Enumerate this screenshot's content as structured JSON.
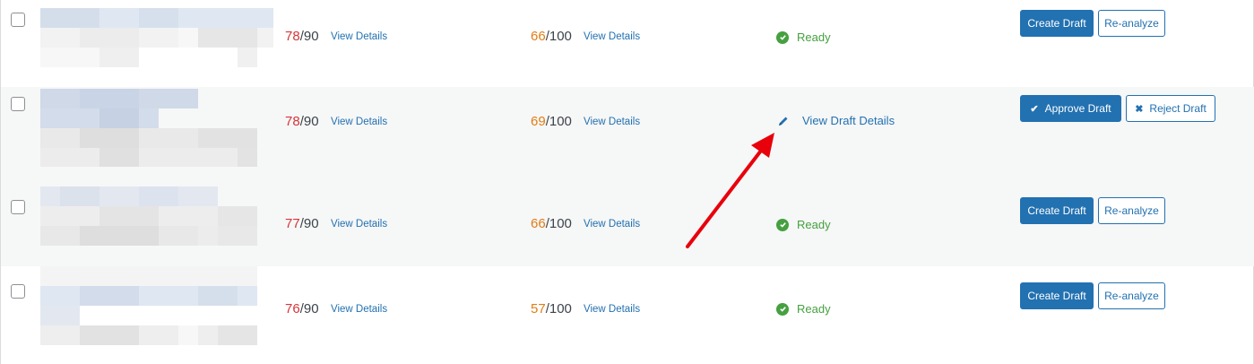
{
  "rows": [
    {
      "seo_value": "78",
      "seo_total": "/90",
      "seo_link": "View Details",
      "read_value": "66",
      "read_total": "/100",
      "read_link": "View Details",
      "status": "Ready",
      "btn1": "Create Draft",
      "btn2": "Re-analyze"
    },
    {
      "seo_value": "78",
      "seo_total": "/90",
      "seo_link": "View Details",
      "read_value": "69",
      "read_total": "/100",
      "read_link": "View Details",
      "draft_link": "View Draft Details",
      "btn1": "Approve Draft",
      "btn2": "Reject Draft"
    },
    {
      "seo_value": "77",
      "seo_total": "/90",
      "seo_link": "View Details",
      "read_value": "66",
      "read_total": "/100",
      "read_link": "View Details",
      "status": "Ready",
      "btn1": "Create Draft",
      "btn2": "Re-analyze"
    },
    {
      "seo_value": "76",
      "seo_total": "/90",
      "seo_link": "View Details",
      "read_value": "57",
      "read_total": "/100",
      "read_link": "View Details",
      "status": "Ready",
      "btn1": "Create Draft",
      "btn2": "Re-analyze"
    }
  ],
  "icons": {
    "checkmark": "check-circle-icon",
    "pencil": "pencil-icon",
    "approve": "checkmark-icon",
    "reject": "x-icon",
    "annotation": "red-arrow-icon"
  },
  "colors": {
    "seo_score": "#d63638",
    "readability_score": "#e17d15",
    "ready_status": "#46a040",
    "primary": "#2271b1",
    "annotation_arrow": "#e8000b"
  }
}
